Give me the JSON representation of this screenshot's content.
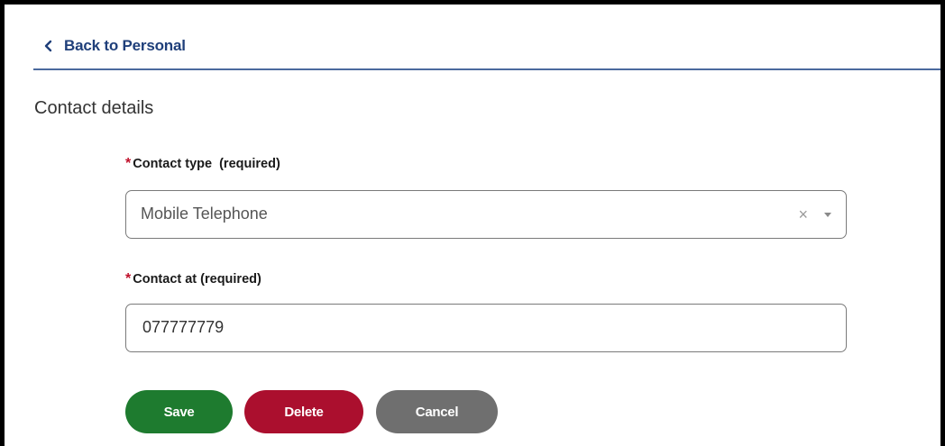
{
  "nav": {
    "back_label": "Back to Personal"
  },
  "section": {
    "title": "Contact details"
  },
  "form": {
    "contact_type": {
      "required_marker": "*",
      "label": "Contact type  (required)",
      "value": "Mobile Telephone",
      "clear_glyph": "×"
    },
    "contact_at": {
      "required_marker": "*",
      "label": "Contact at (required)",
      "value": "077777779"
    }
  },
  "actions": {
    "save_label": "Save",
    "delete_label": "Delete",
    "cancel_label": "Cancel"
  },
  "colors": {
    "link": "#1f3f7a",
    "save": "#1e7b2f",
    "delete": "#ab0f2e",
    "cancel": "#6f6f6f",
    "required": "#c0102a"
  }
}
